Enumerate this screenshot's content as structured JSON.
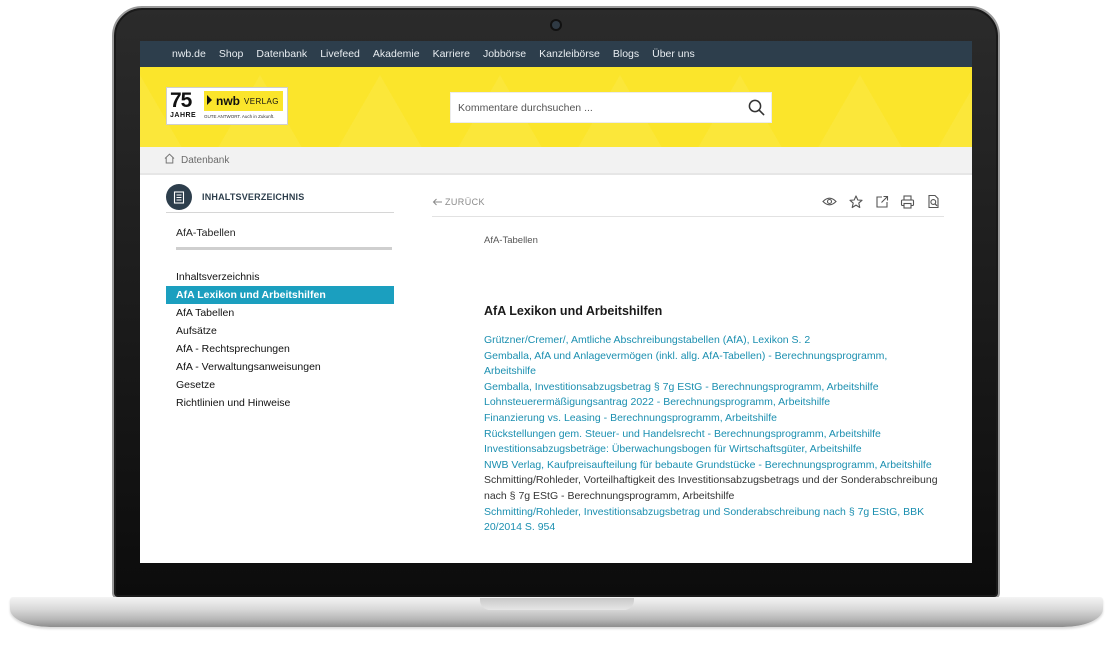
{
  "topnav": [
    "nwb.de",
    "Shop",
    "Datenbank",
    "Livefeed",
    "Akademie",
    "Karriere",
    "Jobbörse",
    "Kanzleibörse",
    "Blogs",
    "Über uns"
  ],
  "logo": {
    "anniversary_number": "75",
    "anniversary_word": "JAHRE",
    "brand": "nwb",
    "brand_suffix": "VERLAG",
    "tagline": "GUTE ANTWORT. Auch in Zukunft."
  },
  "search": {
    "placeholder": "Kommentare durchsuchen ...",
    "icon": "search-icon"
  },
  "breadcrumb": {
    "label": "Datenbank",
    "icon": "home-icon"
  },
  "sidebar": {
    "header": "INHALTSVERZEICHNIS",
    "doc_title": "AfA-Tabellen",
    "items": [
      {
        "label": "Inhaltsverzeichnis",
        "active": false
      },
      {
        "label": "AfA Lexikon und Arbeitshilfen",
        "active": true
      },
      {
        "label": "AfA Tabellen",
        "active": false
      },
      {
        "label": "Aufsätze",
        "active": false
      },
      {
        "label": "AfA - Rechtsprechungen",
        "active": false
      },
      {
        "label": "AfA - Verwaltungsanweisungen",
        "active": false
      },
      {
        "label": "Gesetze",
        "active": false
      },
      {
        "label": "Richtlinien und Hinweise",
        "active": false
      }
    ]
  },
  "main": {
    "back_label": "ZURÜCK",
    "tools": [
      "eye-icon",
      "star-icon",
      "share-icon",
      "print-icon",
      "search-doc-icon"
    ],
    "breadcrumb": "AfA-Tabellen",
    "section_title": "AfA Lexikon und Arbeitshilfen",
    "entries": [
      {
        "text": "Grützner/Cremer/, Amtliche Abschreibungstabellen (AfA), Lexikon S. 2",
        "link": true
      },
      {
        "text": "Gemballa, AfA und Anlagevermögen (inkl. allg. AfA-Tabellen) - Berechnungsprogramm, Arbeitshilfe",
        "link": true
      },
      {
        "text": "Gemballa, Investitionsabzugsbetrag § 7g EStG - Berechnungsprogramm, Arbeitshilfe",
        "link": true
      },
      {
        "text": "Lohnsteuerermäßigungsantrag 2022 - Berechnungsprogramm, Arbeitshilfe",
        "link": true
      },
      {
        "text": "Finanzierung vs. Leasing - Berechnungsprogramm, Arbeitshilfe",
        "link": true
      },
      {
        "text": "Rückstellungen gem. Steuer- und Handelsrecht - Berechnungsprogramm, Arbeitshilfe",
        "link": true
      },
      {
        "text": "Investitionsabzugsbeträge: Überwachungsbogen für Wirtschaftsgüter, Arbeitshilfe",
        "link": true
      },
      {
        "text": "NWB Verlag, Kaufpreisaufteilung für bebaute Grundstücke - Berechnungsprogramm, Arbeitshilfe",
        "link": true
      },
      {
        "text": "Schmitting/Rohleder, Vorteilhaftigkeit des Investitionsabzugsbetrags und der Sonderabschreibung nach § 7g EStG - Berechnungsprogramm, Arbeitshilfe",
        "link": false
      },
      {
        "text": "Schmitting/Rohleder, Investitionsabzugsbetrag und Sonderabschreibung nach § 7g EStG, BBK 20/2014 S. 954",
        "link": true
      }
    ]
  },
  "colors": {
    "nav_bg": "#2d3e4c",
    "banner_yellow": "#fbe52b",
    "accent_teal": "#1b9fbf",
    "link": "#1b8fb0"
  }
}
